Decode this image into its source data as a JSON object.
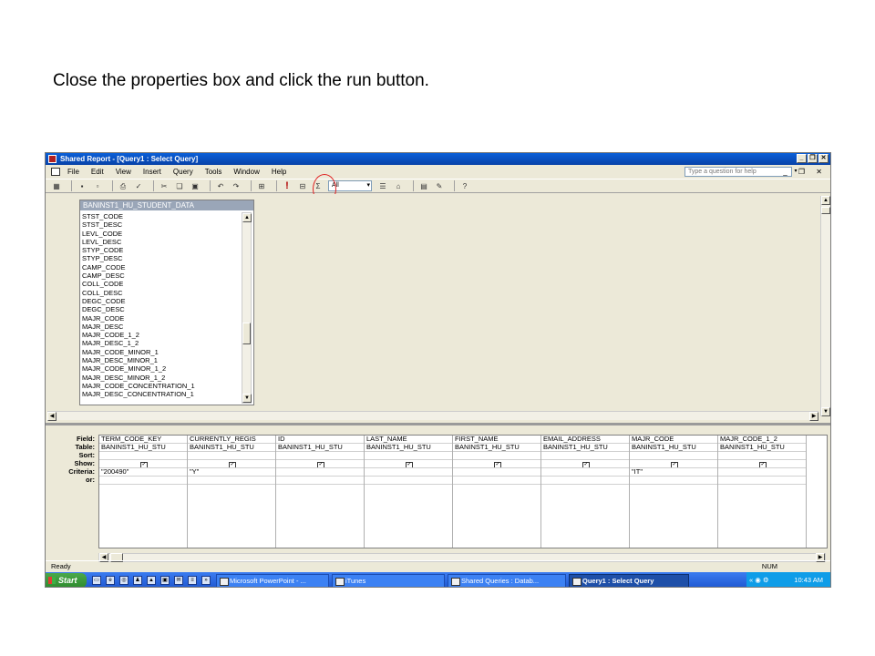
{
  "instruction": "Close the properties box and click the run button.",
  "window": {
    "title": "Shared Report - [Query1 : Select Query]",
    "controls": [
      "_",
      "❐",
      "✕"
    ]
  },
  "menu": {
    "items": [
      "File",
      "Edit",
      "View",
      "Insert",
      "Query",
      "Tools",
      "Window",
      "Help"
    ],
    "help_placeholder": "Type a question for help",
    "doc_controls": "_ ❐ ✕"
  },
  "toolbar": {
    "top_values_select": "All",
    "icons": [
      "view-icon",
      "save-icon",
      "print-preview-icon",
      "print-icon",
      "spelling-icon",
      "cut-icon",
      "copy-icon",
      "paste-icon",
      "undo-icon",
      "redo-icon",
      "query-type-icon",
      "run-icon",
      "show-table-icon",
      "totals-icon",
      "properties-icon",
      "build-icon",
      "database-window-icon",
      "new-object-icon",
      "help-icon"
    ],
    "run_glyph": "!",
    "sigma_glyph": "Σ"
  },
  "table_box": {
    "title": "BANINST1_HU_STUDENT_DATA",
    "fields": [
      "STST_CODE",
      "STST_DESC",
      "LEVL_CODE",
      "LEVL_DESC",
      "STYP_CODE",
      "STYP_DESC",
      "CAMP_CODE",
      "CAMP_DESC",
      "COLL_CODE",
      "COLL_DESC",
      "DEGC_CODE",
      "DEGC_DESC",
      "MAJR_CODE",
      "MAJR_DESC",
      "MAJR_CODE_1_2",
      "MAJR_DESC_1_2",
      "MAJR_CODE_MINOR_1",
      "MAJR_DESC_MINOR_1",
      "MAJR_CODE_MINOR_1_2",
      "MAJR_DESC_MINOR_1_2",
      "MAJR_CODE_CONCENTRATION_1",
      "MAJR_DESC_CONCENTRATION_1"
    ]
  },
  "grid": {
    "row_labels": [
      "Field:",
      "Table:",
      "Sort:",
      "Show:",
      "Criteria:",
      "or:"
    ],
    "columns": [
      {
        "field": "TERM_CODE_KEY",
        "table": "BANINST1_HU_STU",
        "criteria": "\"200490\""
      },
      {
        "field": "CURRENTLY_REGIS",
        "table": "BANINST1_HU_STU",
        "criteria": "\"Y\""
      },
      {
        "field": "ID",
        "table": "BANINST1_HU_STU",
        "criteria": ""
      },
      {
        "field": "LAST_NAME",
        "table": "BANINST1_HU_STU",
        "criteria": ""
      },
      {
        "field": "FIRST_NAME",
        "table": "BANINST1_HU_STU",
        "criteria": ""
      },
      {
        "field": "EMAIL_ADDRESS",
        "table": "BANINST1_HU_STU",
        "criteria": ""
      },
      {
        "field": "MAJR_CODE",
        "table": "BANINST1_HU_STU",
        "criteria": "\"IT\""
      },
      {
        "field": "MAJR_CODE_1_2",
        "table": "BANINST1_HU_STU",
        "criteria": ""
      }
    ]
  },
  "status": {
    "left": "Ready",
    "right": "NUM"
  },
  "taskbar": {
    "start": "Start",
    "buttons": [
      "Microsoft PowerPoint - ...",
      "iTunes",
      "Shared Queries : Datab...",
      "Query1 : Select Query"
    ],
    "clock": "10:43 AM"
  }
}
